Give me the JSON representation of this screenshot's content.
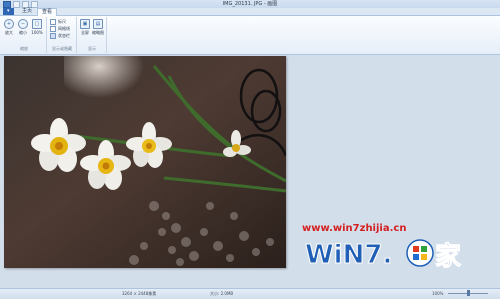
{
  "window": {
    "title": "IMG_20131. JPG - 画图"
  },
  "tabs": {
    "file": "",
    "home": "主页",
    "view": "查看"
  },
  "ribbon": {
    "zoom_in": "放大",
    "zoom_out": "缩小",
    "actual_size": "100%",
    "zoom_group": "缩放",
    "ruler": "标尺",
    "gridlines": "网格线",
    "statusbar": "状态栏",
    "show_group": "显示或隐藏",
    "fullscreen": "全屏",
    "thumbnail": "缩略图",
    "display_group": "显示"
  },
  "watermark": {
    "url": "www.win7zhijia.cn",
    "logo_text": "Win7之家"
  },
  "status": {
    "dimensions": "3264 × 2448像素",
    "size": "大小: 2.0MB",
    "zoom": "100%"
  },
  "colors": {
    "accent": "#2f66b4",
    "watermark_red": "#d32020",
    "watermark_blue": "#1f5fb5"
  }
}
